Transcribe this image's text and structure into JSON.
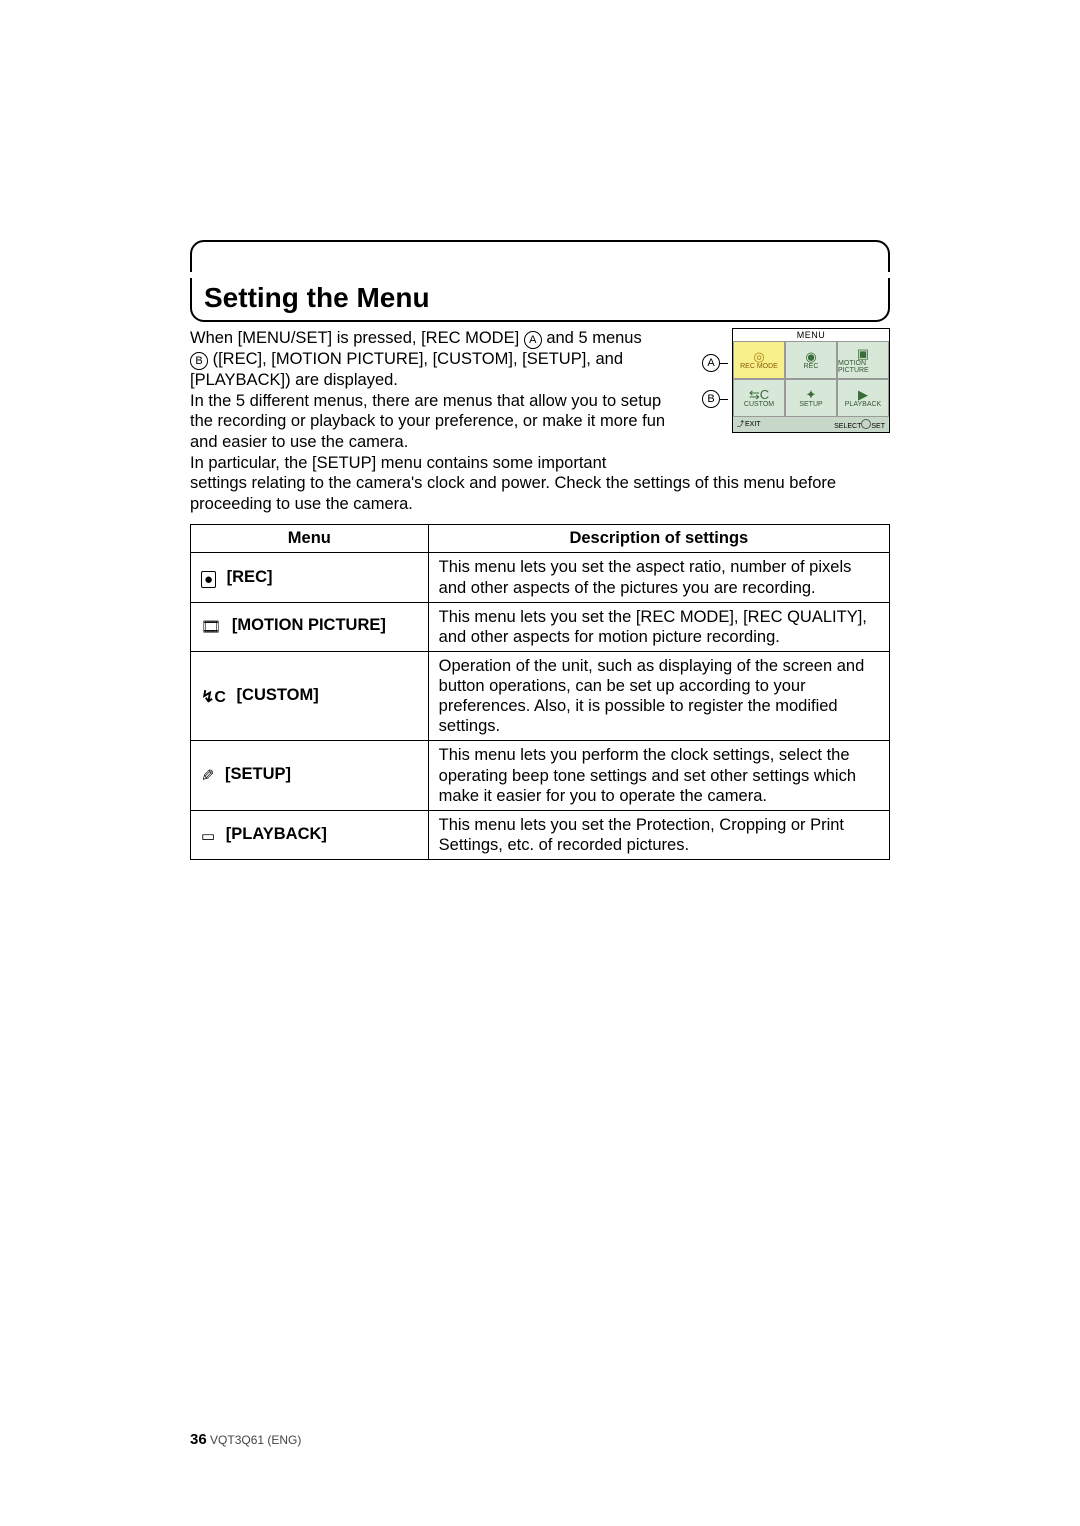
{
  "title": "Setting the Menu",
  "para1_pre": "When [MENU/SET] is pressed, [REC MODE] ",
  "para1_mid": " and 5 menus ",
  "para1_b_after": " ([REC], [MOTION PICTURE], [CUSTOM], [SETUP], and [PLAYBACK]) are displayed.",
  "para2": "In the 5 different menus, there are menus that allow you to setup the recording or playback to your preference, or make it more fun and easier to use the camera.",
  "para3": "In particular, the [SETUP] menu contains some important settings relating to the camera's clock and power. Check the settings of this menu before proceeding to use the camera.",
  "callout_A": "A",
  "callout_B": "B",
  "screenshot": {
    "title": "MENU",
    "cells": [
      {
        "label": "REC MODE",
        "highlight": true
      },
      {
        "label": "REC",
        "highlight": false
      },
      {
        "label": "MOTION PICTURE",
        "highlight": false
      },
      {
        "label": "CUSTOM",
        "highlight": false
      },
      {
        "label": "SETUP",
        "highlight": false
      },
      {
        "label": "PLAYBACK",
        "highlight": false
      }
    ],
    "footer_left": "EXIT",
    "footer_select": "SELECT",
    "footer_set": "SET"
  },
  "table": {
    "h1": "Menu",
    "h2": "Description of settings",
    "rows": [
      {
        "name": "[REC]",
        "desc": "This menu lets you set the aspect ratio, number of pixels and other aspects of the pictures you are recording."
      },
      {
        "name": "[MOTION PICTURE]",
        "desc": "This menu lets you set the [REC MODE], [REC QUALITY], and other aspects for motion picture recording."
      },
      {
        "name": "[CUSTOM]",
        "desc": "Operation of the unit, such as displaying of the screen and button operations, can be set up according to your preferences. Also, it is possible to register the modified settings."
      },
      {
        "name": "[SETUP]",
        "desc": "This menu lets you perform the clock settings, select the operating beep tone settings and set other settings which make it easier for you to operate the camera."
      },
      {
        "name": "[PLAYBACK]",
        "desc": "This menu lets you set the Protection, Cropping or Print Settings, etc. of recorded pictures."
      }
    ]
  },
  "footer": {
    "page": "36",
    "doc_id": "VQT3Q61 (ENG)"
  }
}
